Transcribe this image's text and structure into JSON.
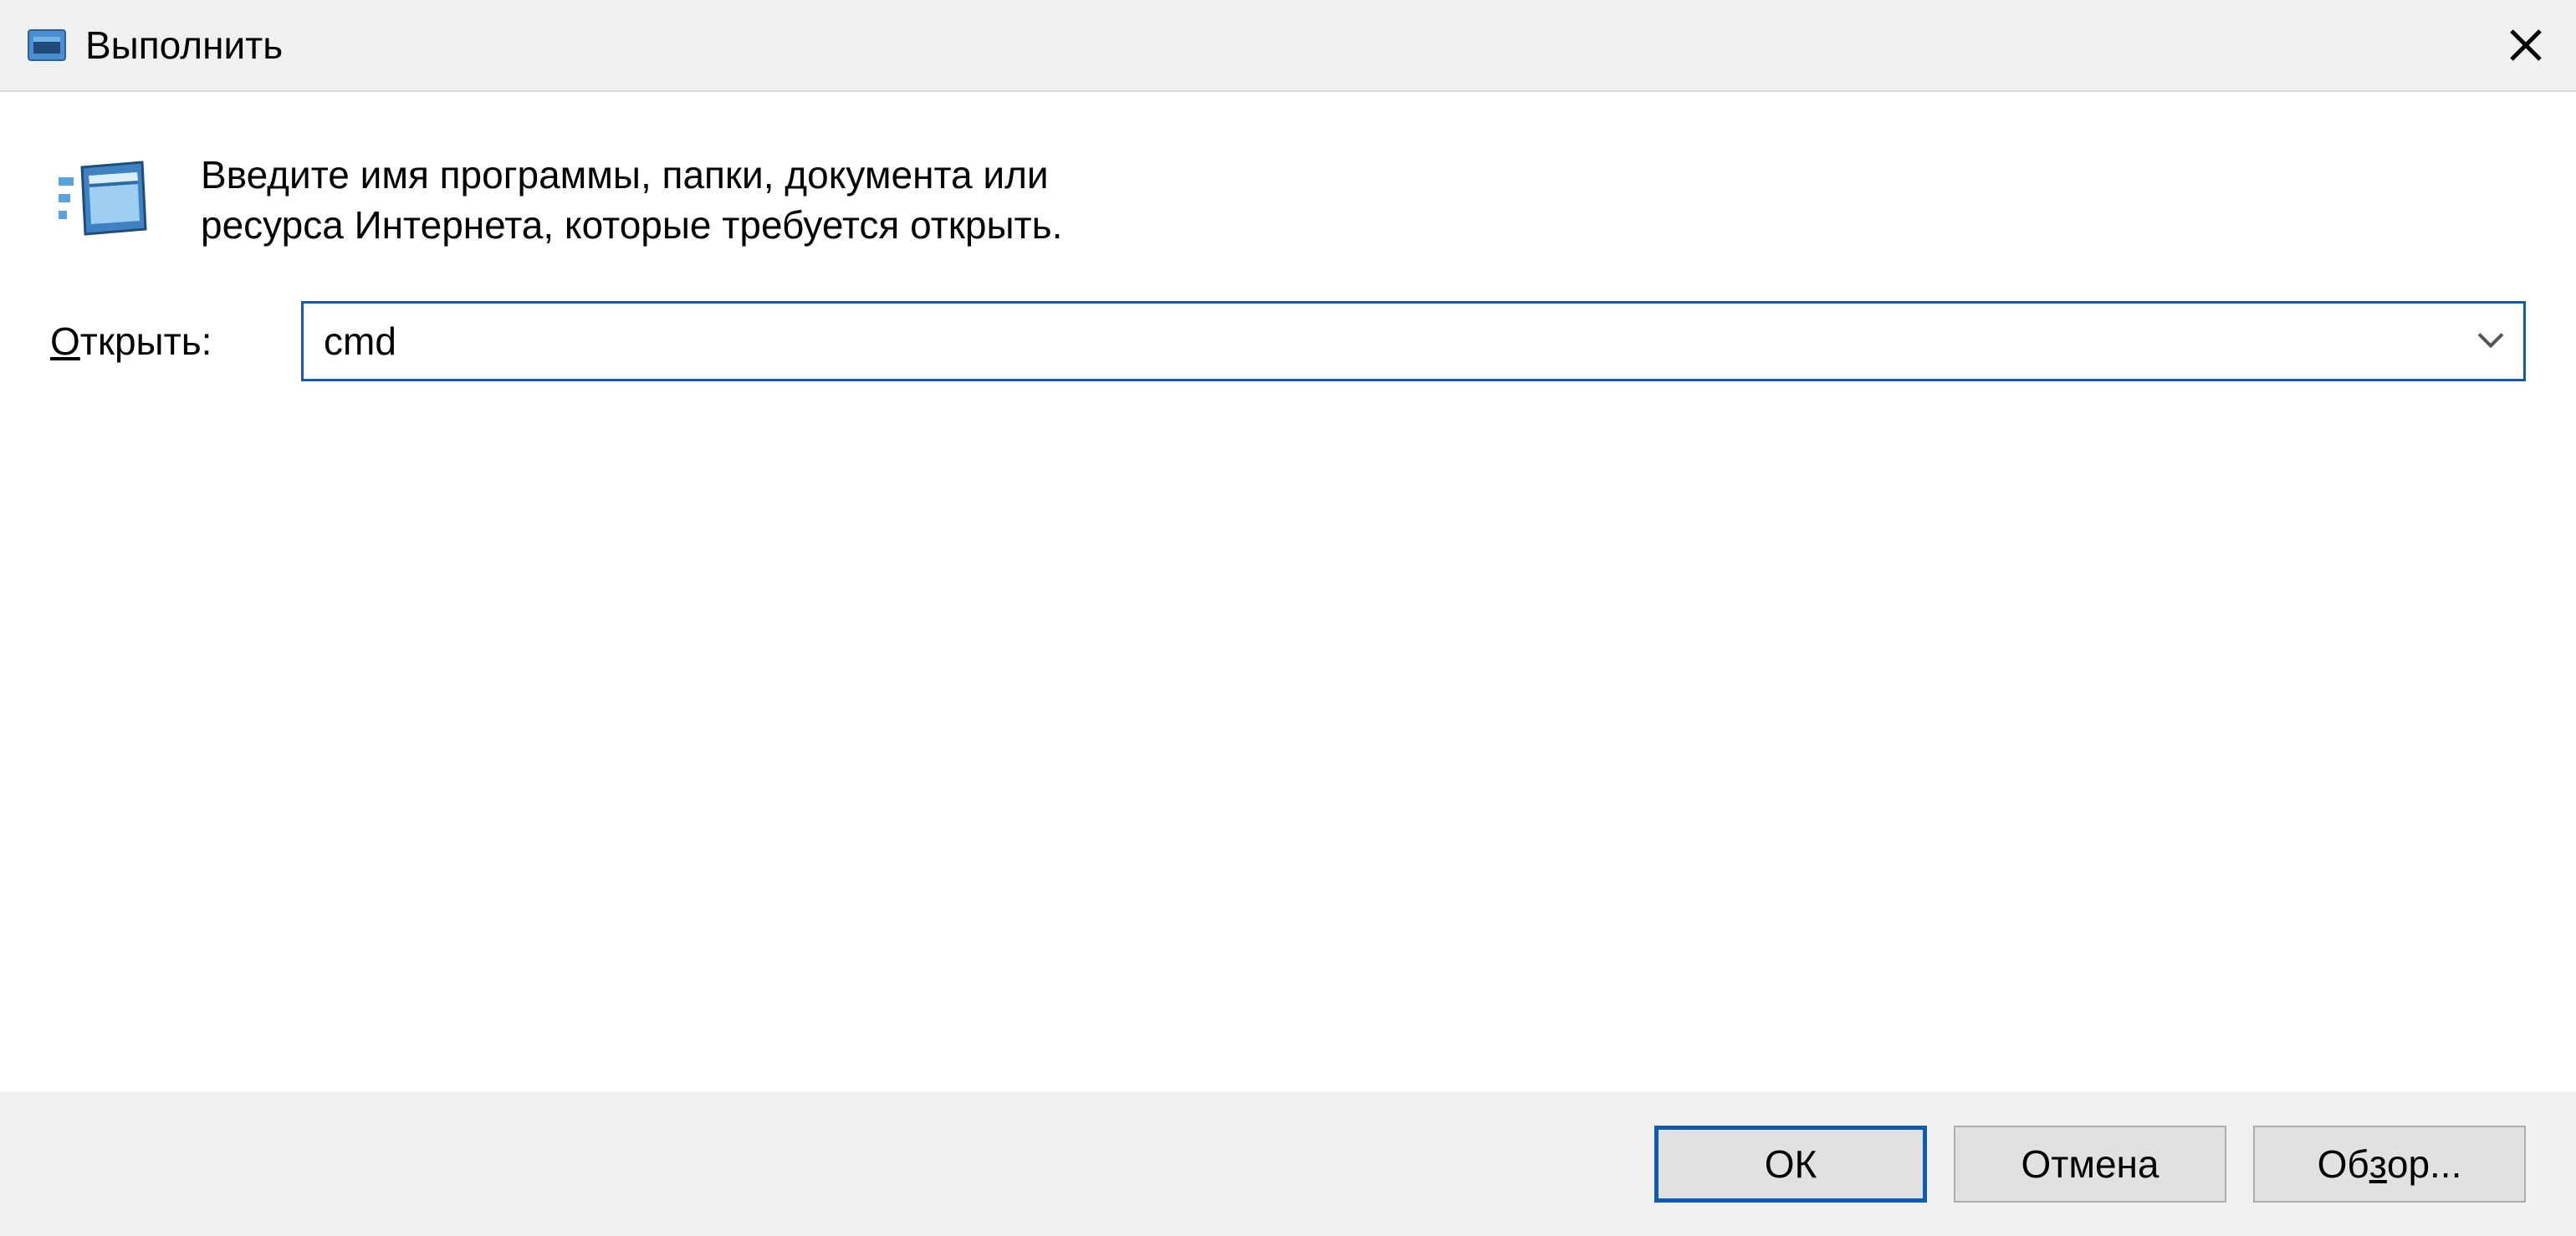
{
  "titlebar": {
    "title": "Выполнить"
  },
  "content": {
    "description": "Введите имя программы, папки, документа или ресурса Интернета, которые требуется открыть.",
    "open_label_prefix": "О",
    "open_label_rest": "ткрыть:",
    "input_value": "cmd"
  },
  "buttons": {
    "ok": "ОК",
    "cancel": "Отмена",
    "browse_prefix": "Об",
    "browse_underline": "з",
    "browse_rest": "ор..."
  }
}
